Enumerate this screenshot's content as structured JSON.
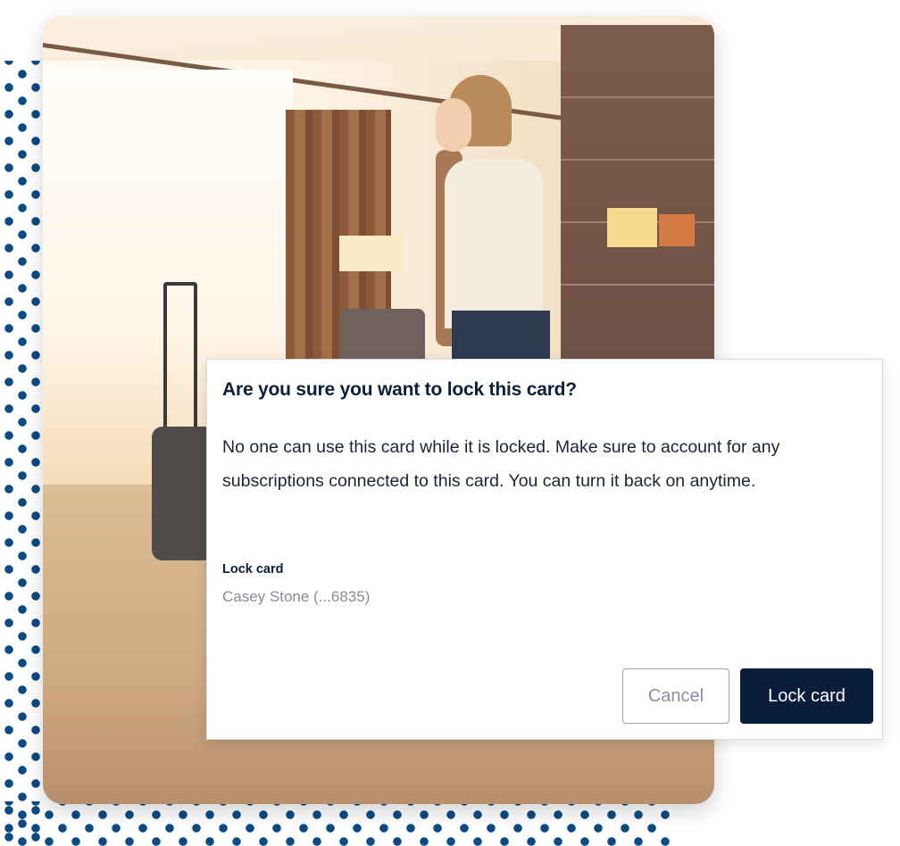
{
  "theme": {
    "dot_color": "#0d4a85",
    "primary_button_color": "#0a1d3a",
    "title_color": "#0b1f3a",
    "muted_text_color": "#868c94"
  },
  "background_photo": {
    "description": "Woman in a hotel room holding a phone and glasses, suitcase on carpet"
  },
  "dialog": {
    "title": "Are you sure you want to lock this card?",
    "body": "No one can use this card while it is locked. Make sure to account for any subscriptions connected to this card. You can turn it back on anytime.",
    "field_label": "Lock card",
    "field_value": "Casey Stone (...6835)",
    "buttons": {
      "cancel": "Cancel",
      "confirm": "Lock card"
    }
  }
}
